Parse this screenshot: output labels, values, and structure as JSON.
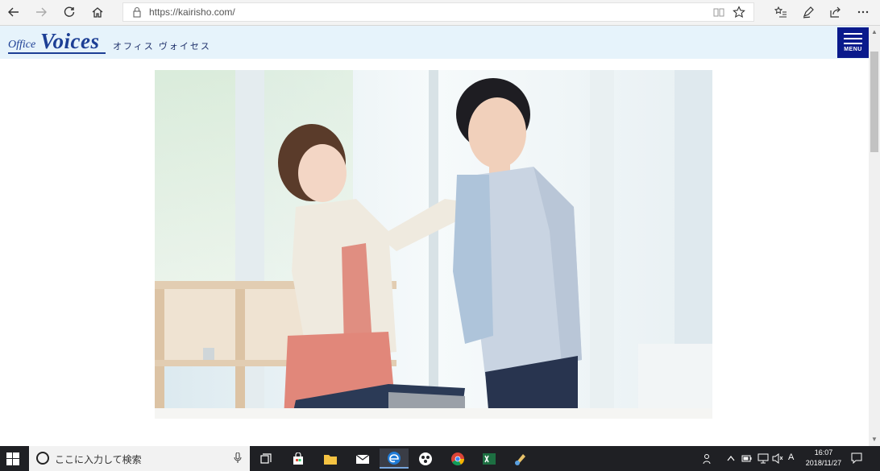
{
  "browser": {
    "url": "https://kairisho.com/",
    "icons": [
      "back-icon",
      "forward-icon",
      "refresh-icon",
      "home-icon",
      "lock-icon",
      "reading-view-icon",
      "favorite-star-icon",
      "favorites-hub-icon",
      "pen-icon",
      "share-icon",
      "more-icon"
    ]
  },
  "site": {
    "logo_office": "Office",
    "logo_voices": "Voices",
    "logo_jp": "オフィス ヴォイセス",
    "menu_label": "MENU"
  },
  "taskbar": {
    "search_placeholder": "ここに入力して検索",
    "apps": [
      "task-view-icon",
      "store-icon",
      "file-explorer-icon",
      "mail-icon",
      "edge-icon",
      "app-icon",
      "chrome-icon",
      "excel-icon",
      "paint-icon"
    ],
    "ime_label": "A",
    "time": "16:07",
    "date": "2018/11/27"
  },
  "colors": {
    "brand_blue": "#1d3f95",
    "menu_bg": "#0a1a8c",
    "header_bg": "#e6f3fb",
    "taskbar_bg": "#1f2024"
  }
}
